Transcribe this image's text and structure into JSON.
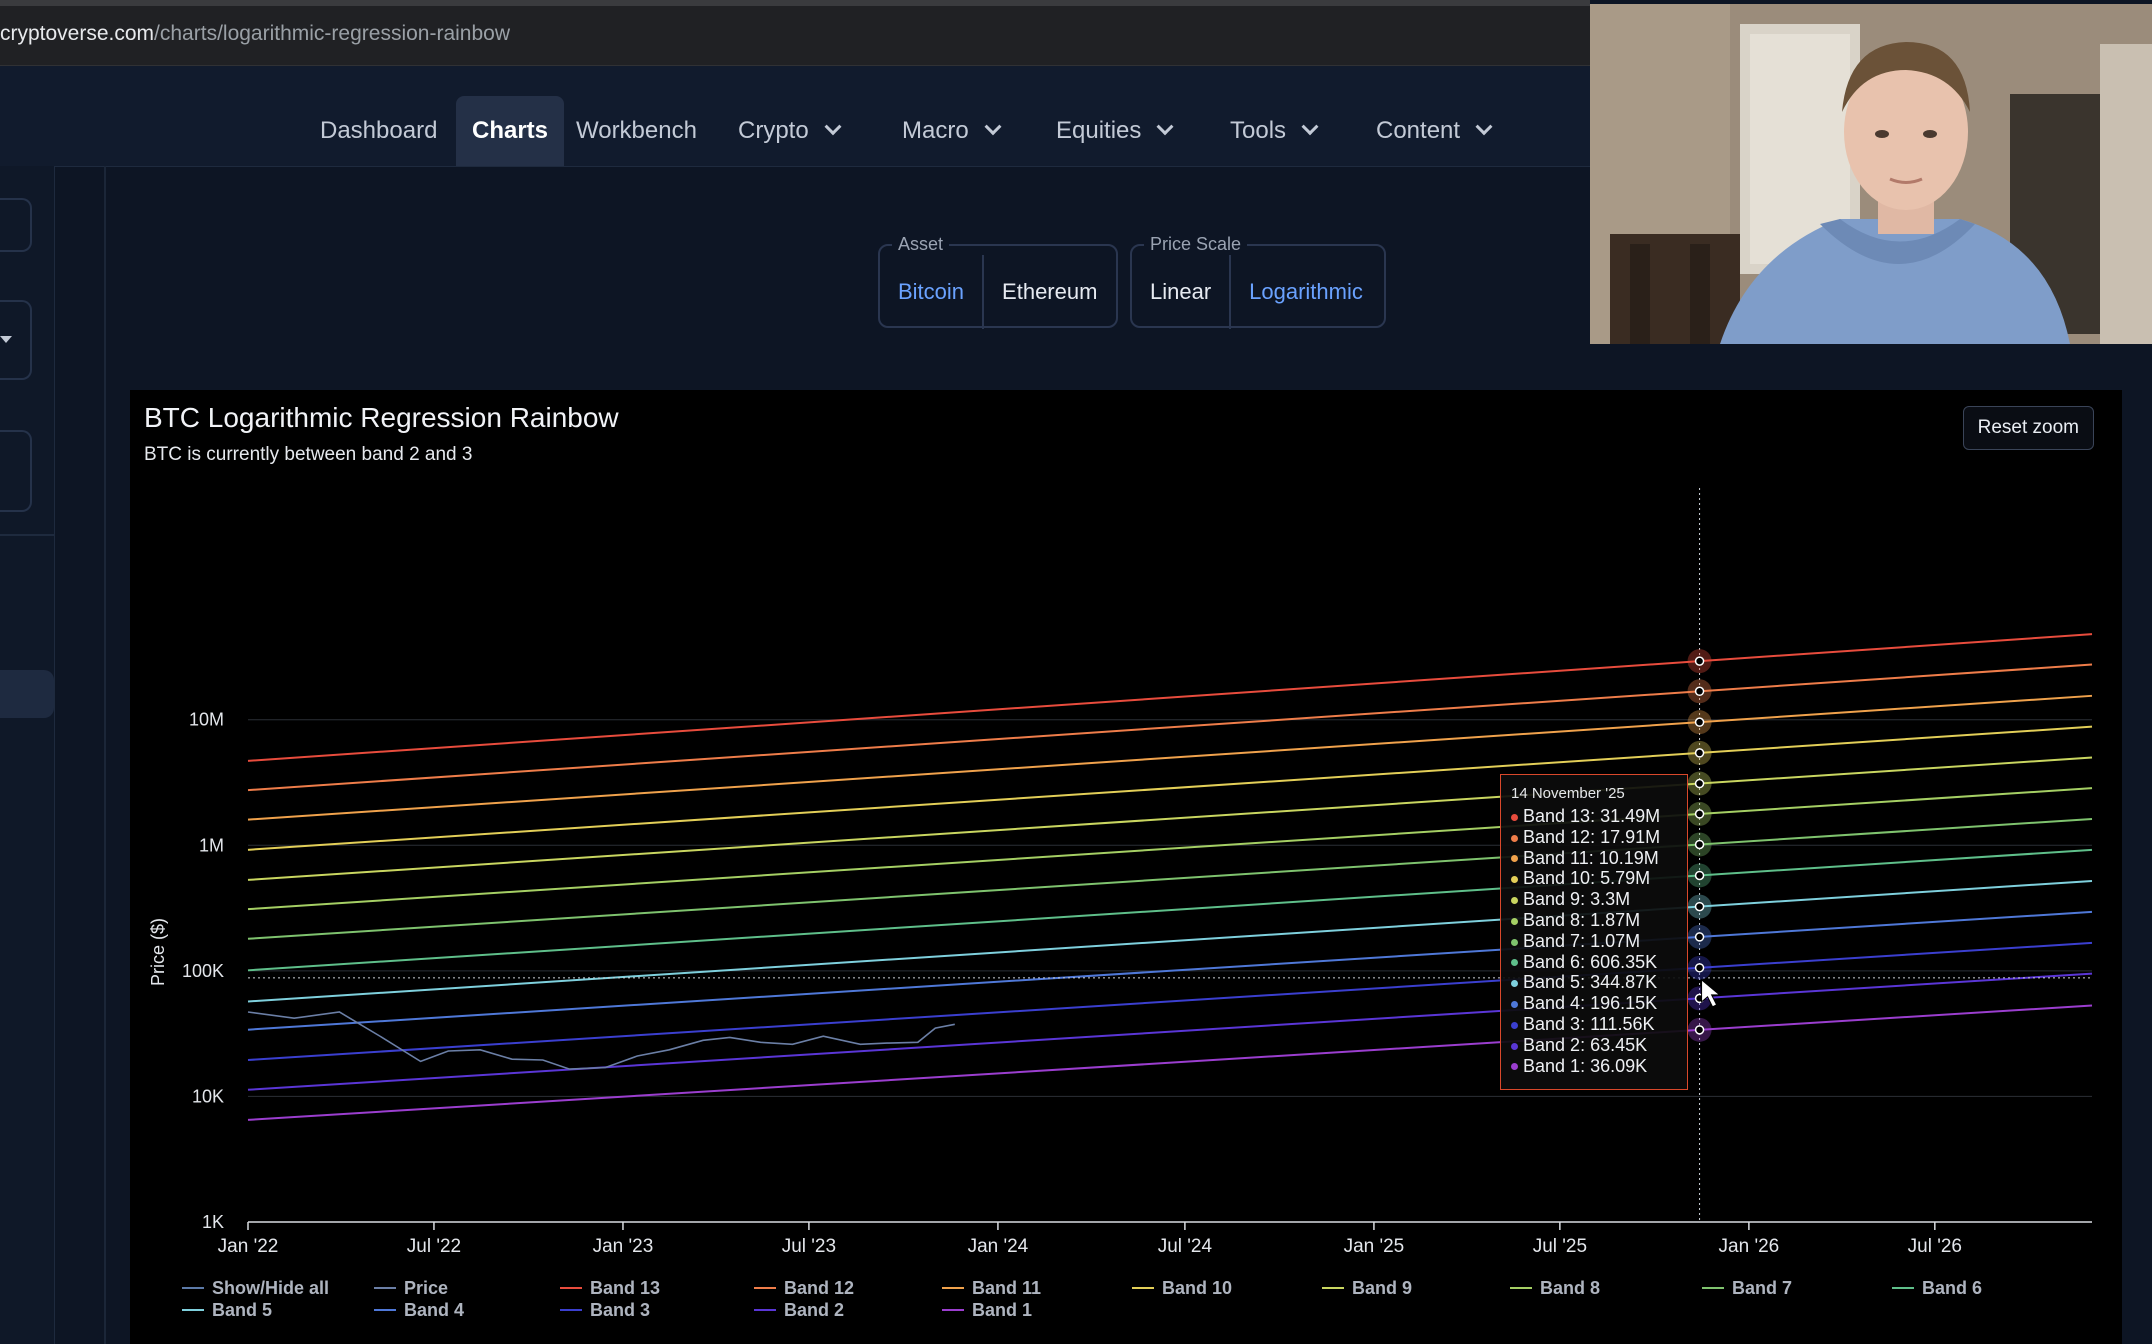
{
  "browser": {
    "url_domain": "cryptoverse.com",
    "url_path": "/charts/logarithmic-regression-rainbow"
  },
  "nav": {
    "items": [
      {
        "label": "Dashboard",
        "dropdown": false,
        "active": false
      },
      {
        "label": "Charts",
        "dropdown": false,
        "active": true
      },
      {
        "label": "Workbench",
        "dropdown": false,
        "active": false
      },
      {
        "label": "Crypto",
        "dropdown": true,
        "active": false
      },
      {
        "label": "Macro",
        "dropdown": true,
        "active": false
      },
      {
        "label": "Equities",
        "dropdown": true,
        "active": false
      },
      {
        "label": "Tools",
        "dropdown": true,
        "active": false
      },
      {
        "label": "Content",
        "dropdown": true,
        "active": false
      }
    ]
  },
  "controls": {
    "asset": {
      "legend": "Asset",
      "options": [
        "Bitcoin",
        "Ethereum"
      ],
      "selected": "Bitcoin"
    },
    "price_scale": {
      "legend": "Price Scale",
      "options": [
        "Linear",
        "Logarithmic"
      ],
      "selected": "Logarithmic"
    }
  },
  "chart": {
    "title": "BTC Logarithmic Regression Rainbow",
    "subtitle": "BTC is currently between band 2 and 3",
    "reset_zoom_label": "Reset zoom"
  },
  "chart_data": {
    "type": "line",
    "title": "BTC Logarithmic Regression Rainbow",
    "subtitle": "BTC is currently between band 2 and 3",
    "ylabel": "Price ($)",
    "xlabel": "",
    "yscale": "log",
    "ylim": [
      1000,
      60000000
    ],
    "xlim": [
      "2022-01-01",
      "2026-12-01"
    ],
    "x_ticks": [
      "Jan '22",
      "Jul '22",
      "Jan '23",
      "Jul '23",
      "Jan '24",
      "Jul '24",
      "Jan '25",
      "Jul '25",
      "Jan '26",
      "Jul '26"
    ],
    "y_ticks": [
      "1K",
      "10K",
      "100K",
      "1M",
      "10M"
    ],
    "y_tick_values": [
      1000,
      10000,
      100000,
      1000000,
      10000000
    ],
    "grid": true,
    "legend_placement": "bottom",
    "colors": {
      "Band 13": "#e84c3d",
      "Band 12": "#ef7d4a",
      "Band 11": "#f0a24c",
      "Band 10": "#e3cf58",
      "Band 9": "#c9d660",
      "Band 8": "#a5cf64",
      "Band 7": "#7fc36e",
      "Band 6": "#5fbf8a",
      "Band 5": "#7fd0dd",
      "Band 4": "#4f78d8",
      "Band 3": "#3b3fcf",
      "Band 2": "#5a36d6",
      "Band 1": "#9b3ecf",
      "Price": "#6b7fa6"
    },
    "bands": [
      {
        "name": "Band 13",
        "start": 4700000,
        "end": 48000000
      },
      {
        "name": "Band 12",
        "start": 2750000,
        "end": 27500000
      },
      {
        "name": "Band 11",
        "start": 1600000,
        "end": 15500000
      },
      {
        "name": "Band 10",
        "start": 920000,
        "end": 8800000
      },
      {
        "name": "Band 9",
        "start": 530000,
        "end": 5000000
      },
      {
        "name": "Band 8",
        "start": 310000,
        "end": 2850000
      },
      {
        "name": "Band 7",
        "start": 180000,
        "end": 1620000
      },
      {
        "name": "Band 6",
        "start": 101000,
        "end": 920000
      },
      {
        "name": "Band 5",
        "start": 57000,
        "end": 520000
      },
      {
        "name": "Band 4",
        "start": 34000,
        "end": 295000
      },
      {
        "name": "Band 3",
        "start": 19500,
        "end": 167000
      },
      {
        "name": "Band 2",
        "start": 11300,
        "end": 95000
      },
      {
        "name": "Band 1",
        "start": 6500,
        "end": 53000
      }
    ],
    "price": {
      "name": "Price",
      "x": [
        "2022-01-01",
        "2022-02-15",
        "2022-03-31",
        "2022-05-10",
        "2022-06-18",
        "2022-07-15",
        "2022-08-15",
        "2022-09-15",
        "2022-10-15",
        "2022-11-10",
        "2022-12-15",
        "2023-01-15",
        "2023-02-15",
        "2023-03-20",
        "2023-04-15",
        "2023-05-15",
        "2023-06-15",
        "2023-07-15",
        "2023-08-20",
        "2023-09-15",
        "2023-10-15",
        "2023-11-01",
        "2023-11-20"
      ],
      "y": [
        47000,
        42000,
        47000,
        30000,
        19000,
        23000,
        23500,
        19800,
        19500,
        16500,
        17000,
        21000,
        23500,
        28000,
        29500,
        27000,
        26000,
        30200,
        26000,
        26600,
        27000,
        35000,
        37500
      ]
    },
    "tooltip": {
      "date": "14 November '25",
      "rows": [
        {
          "name": "Band 13",
          "value": "31.49M"
        },
        {
          "name": "Band 12",
          "value": "17.91M"
        },
        {
          "name": "Band 11",
          "value": "10.19M"
        },
        {
          "name": "Band 10",
          "value": "5.79M"
        },
        {
          "name": "Band 9",
          "value": "3.3M"
        },
        {
          "name": "Band 8",
          "value": "1.87M"
        },
        {
          "name": "Band 7",
          "value": "1.07M"
        },
        {
          "name": "Band 6",
          "value": "606.35K"
        },
        {
          "name": "Band 5",
          "value": "344.87K"
        },
        {
          "name": "Band 4",
          "value": "196.15K"
        },
        {
          "name": "Band 3",
          "value": "111.56K"
        },
        {
          "name": "Band 2",
          "value": "63.45K"
        },
        {
          "name": "Band 1",
          "value": "36.09K"
        }
      ],
      "crosshair_date": "2025-11-14",
      "crosshair_price": 88000
    },
    "legend": [
      "Show/Hide all",
      "Price",
      "Band 13",
      "Band 12",
      "Band 11",
      "Band 10",
      "Band 9",
      "Band 8",
      "Band 7",
      "Band 6",
      "Band 5",
      "Band 4",
      "Band 3",
      "Band 2",
      "Band 1"
    ]
  }
}
